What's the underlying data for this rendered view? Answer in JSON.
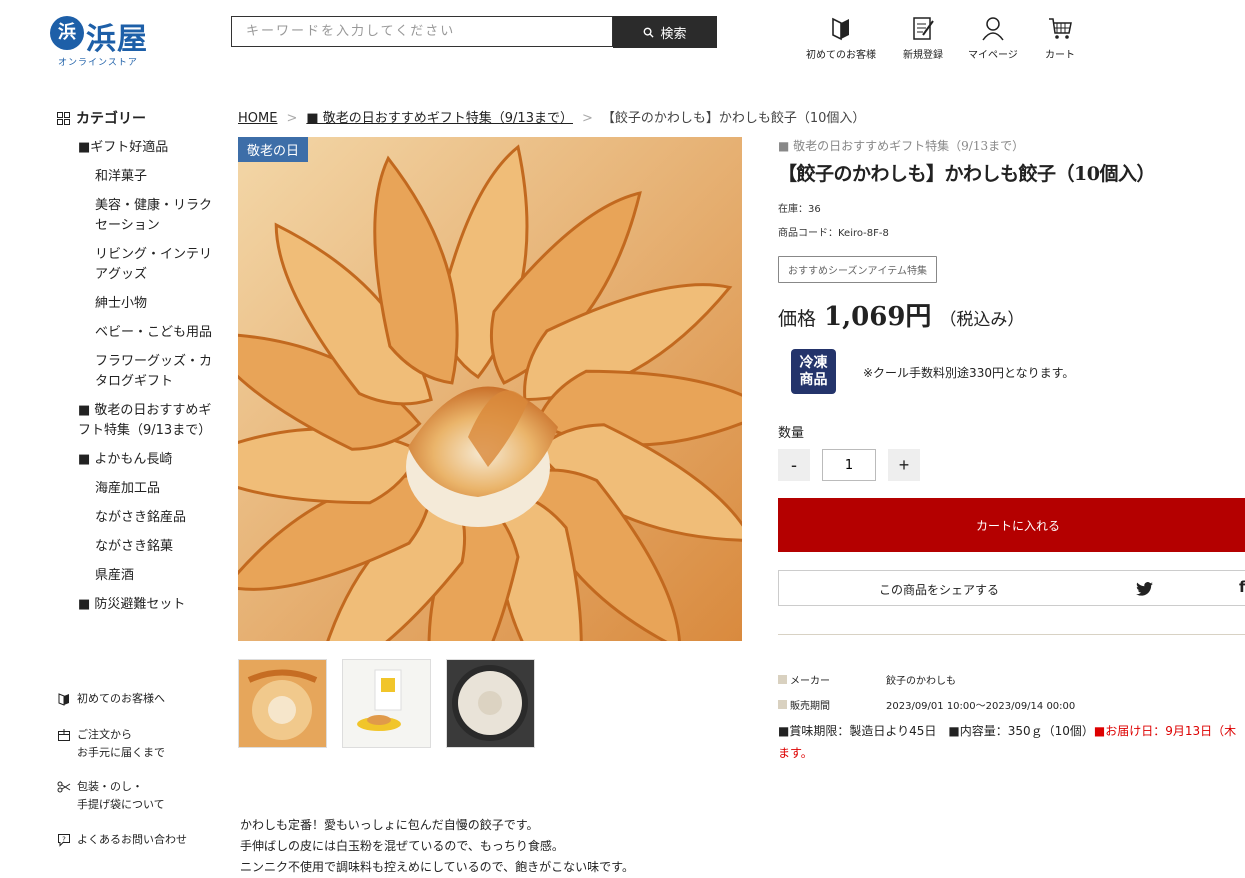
{
  "header": {
    "logo_text": "浜屋",
    "logo_sub": "オンラインストア",
    "search_placeholder": "キーワードを入力してください",
    "search_button": "検索",
    "nav": {
      "first_time": "初めてのお客様",
      "register": "新規登録",
      "mypage": "マイページ",
      "cart": "カート"
    }
  },
  "sidebar": {
    "category_title": "カテゴリー",
    "categories": [
      {
        "label": "■ギフト好適品"
      },
      {
        "label": "和洋菓子"
      },
      {
        "label": "美容・健康・リラクセーション"
      },
      {
        "label": "リビング・インテリアグッズ"
      },
      {
        "label": "紳士小物"
      },
      {
        "label": "ベビー・こども用品"
      },
      {
        "label": "フラワーグッズ・カタログギフト"
      },
      {
        "label": "■ 敬老の日おすすめギフト特集（9/13まで）"
      },
      {
        "label": "■ よかもん長崎"
      },
      {
        "label": "海産加工品"
      },
      {
        "label": "ながさき銘産品"
      },
      {
        "label": "ながさき銘菓"
      },
      {
        "label": "県産酒"
      },
      {
        "label": "■ 防災避難セット"
      }
    ],
    "links": {
      "first_guide": "初めてのお客様へ",
      "order_flow_1": "ご注文から",
      "order_flow_2": "お手元に届くまで",
      "wrapping_1": "包装・のし・",
      "wrapping_2": "手提げ袋について",
      "faq": "よくあるお問い合わせ"
    }
  },
  "breadcrumb": {
    "home": "HOME",
    "category": "■ 敬老の日おすすめギフト特集（9/13まで）",
    "current": "【餃子のかわしも】かわしも餃子（10個入）"
  },
  "product": {
    "badge": "敬老の日",
    "category_line": "■ 敬老の日おすすめギフト特集（9/13まで）",
    "title": "【餃子のかわしも】かわしも餃子（10個入）",
    "stock": "在庫：36",
    "code": "商品コード：Keiro-8F-8",
    "tag": "おすすめシーズンアイテム特集",
    "price_label": "価格",
    "price": "1,069円",
    "tax": "（税込み）",
    "frozen_1": "冷凍",
    "frozen_2": "商品",
    "cool_note": "※クール手数料別途330円となります。",
    "qty_label": "数量",
    "qty_minus": "-",
    "qty_value": "1",
    "qty_plus": "+",
    "cart_button": "カートに入れる",
    "share_label": "この商品をシェアする",
    "specs": {
      "maker_k": "メーカー",
      "maker_v": "餃子のかわしも",
      "period_k": "販売期間",
      "period_v": "2023/09/01 10:00〜2023/09/14 00:00"
    },
    "notes_1": "■賞味期限：製造日より45日　■内容量：350ｇ（10個）",
    "notes_red": "■お届け日：9月13日（木",
    "notes_2": "ます。",
    "description": [
      "かわしも定番！愛もいっしょに包んだ自慢の餃子です。",
      " 手伸ばしの皮には白玉粉を混ぜているので、もっちり食感。",
      "ニンニク不使用で調味料も控えめにしているので、飽きがこない味です。"
    ]
  },
  "colors": {
    "brand_blue": "#1d5fa8",
    "cart_red": "#b40000",
    "badge_blue": "#3d6ea8",
    "frozen_navy": "#24346b"
  }
}
